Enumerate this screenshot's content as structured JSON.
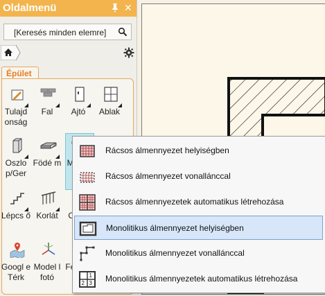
{
  "panel": {
    "title": "Oldalmenü",
    "pin_label": "ꟷ",
    "close_label": "✕",
    "search_placeholder": "[Keresés minden elemre]",
    "tab": "Épület",
    "tools": [
      {
        "label": "Tulajd onság",
        "icon": "property-icon"
      },
      {
        "label": "Fal",
        "icon": "wall-icon"
      },
      {
        "label": "Ajtó",
        "icon": "door-icon"
      },
      {
        "label": "Ablak",
        "icon": "window-icon"
      },
      {
        "label": "Oszlo p/Ger",
        "icon": "column-icon"
      },
      {
        "label": "Födé m",
        "icon": "slab-icon"
      },
      {
        "label": "Me ye",
        "icon": "ceiling-icon"
      },
      {
        "label": "Lépcs ő",
        "icon": "stairs-icon"
      },
      {
        "label": "Korlát",
        "icon": "railing-icon"
      },
      {
        "label": "Ob tu",
        "icon": "object-icon"
      },
      {
        "label": "Googl e Térk",
        "icon": "google-map-icon"
      },
      {
        "label": "Model l fotó",
        "icon": "model-photo-icon"
      },
      {
        "label": "Fel rt h",
        "icon": "surface-icon"
      }
    ]
  },
  "popup": {
    "items": [
      {
        "label": "Rácsos álmennyezet helyiségben",
        "icon": "grid-ceiling-room-icon"
      },
      {
        "label": "Rácsos álmennyezet vonallánccal",
        "icon": "grid-ceiling-polyline-icon"
      },
      {
        "label": "Rácsos álmennyezetek automatikus létrehozása",
        "icon": "grid-ceiling-auto-icon"
      },
      {
        "label": "Monolitikus álmennyezet helyiségben",
        "icon": "monolithic-ceiling-room-icon"
      },
      {
        "label": "Monolitikus álmennyezet vonallánccal",
        "icon": "monolithic-ceiling-polyline-icon"
      },
      {
        "label": "Monolitikus álmennyezetek automatikus létrehozása",
        "icon": "monolithic-ceiling-auto-icon"
      }
    ],
    "active_index": 3
  },
  "colors": {
    "accent": "#f3b44d",
    "tab_text": "#e77e1f",
    "highlight": "#d7e6f8"
  }
}
